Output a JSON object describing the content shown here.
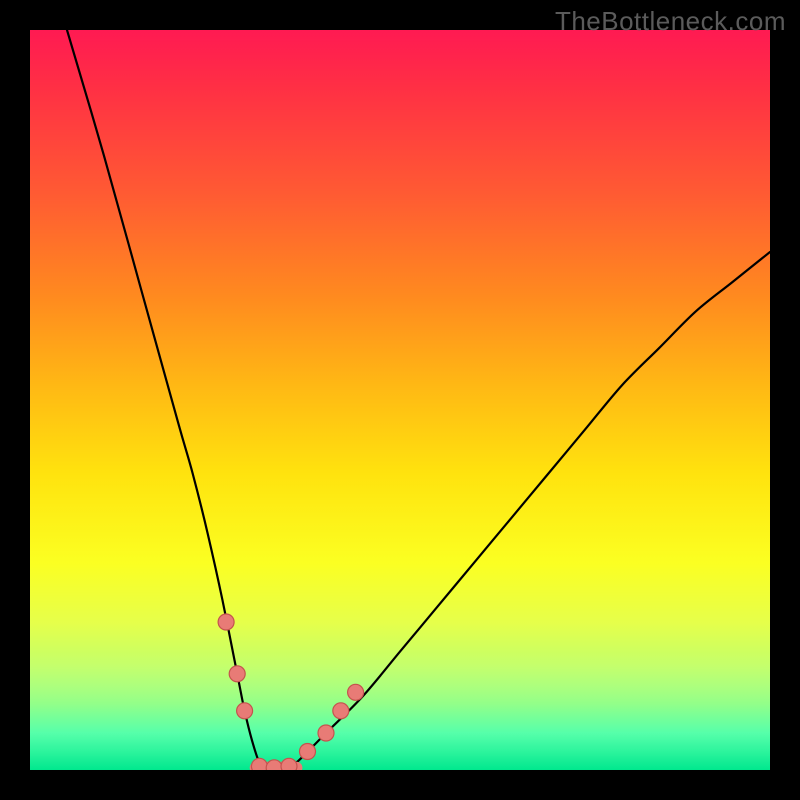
{
  "watermark": "TheBottleneck.com",
  "chart_data": {
    "type": "line",
    "title": "",
    "xlabel": "",
    "ylabel": "",
    "xlim": [
      0,
      100
    ],
    "ylim": [
      0,
      100
    ],
    "series": [
      {
        "name": "bottleneck-curve",
        "x": [
          5,
          10,
          15,
          20,
          22,
          24,
          26,
          28,
          29,
          30,
          31,
          32,
          34,
          36,
          40,
          45,
          50,
          55,
          60,
          65,
          70,
          75,
          80,
          85,
          90,
          95,
          100
        ],
        "values": [
          100,
          83,
          65,
          47,
          40,
          32,
          23,
          13,
          8,
          4,
          1,
          0,
          0,
          1,
          5,
          10,
          16,
          22,
          28,
          34,
          40,
          46,
          52,
          57,
          62,
          66,
          70
        ]
      }
    ],
    "markers": [
      {
        "x": 26.5,
        "y": 20
      },
      {
        "x": 28.0,
        "y": 13
      },
      {
        "x": 29.0,
        "y": 8
      },
      {
        "x": 31.0,
        "y": 0.5
      },
      {
        "x": 33.0,
        "y": 0.3
      },
      {
        "x": 35.0,
        "y": 0.5
      },
      {
        "x": 37.5,
        "y": 2.5
      },
      {
        "x": 40.0,
        "y": 5
      },
      {
        "x": 42.0,
        "y": 8
      },
      {
        "x": 44.0,
        "y": 10.5
      }
    ],
    "valley_band": {
      "x_start": 30.5,
      "x_end": 36.0,
      "y": 0.3
    },
    "background_gradient": {
      "top": "#ff1a52",
      "mid": "#ffe30e",
      "bottom": "#00e88e"
    }
  }
}
